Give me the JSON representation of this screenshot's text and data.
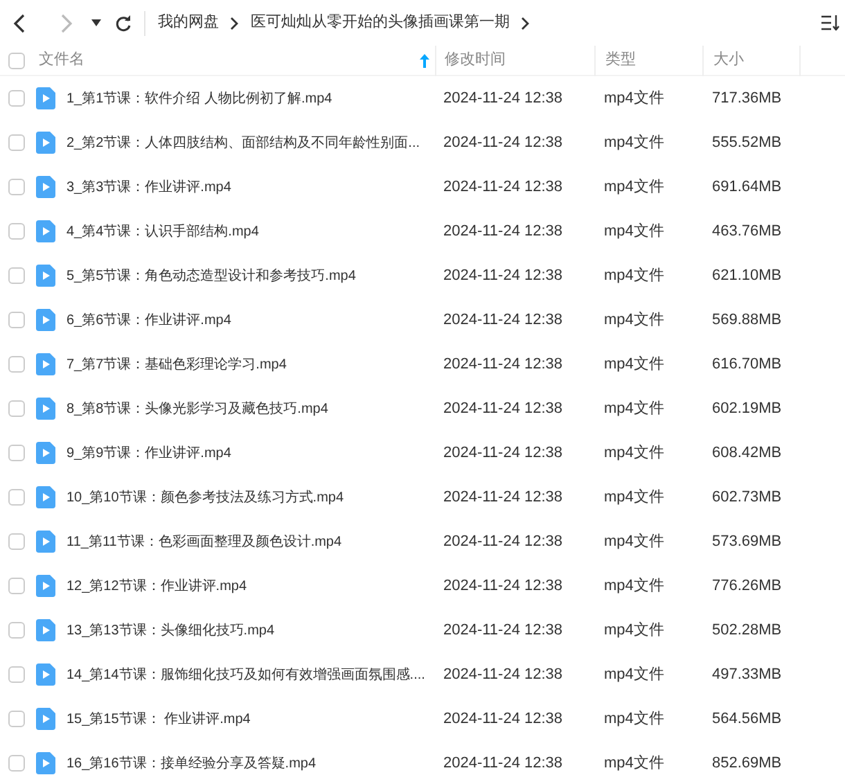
{
  "breadcrumb": [
    "我的网盘",
    "医可灿灿从零开始的头像插画课第一期"
  ],
  "columns": [
    {
      "label": "文件名",
      "sorted": true
    },
    {
      "label": "修改时间",
      "sorted": false
    },
    {
      "label": "类型",
      "sorted": false
    },
    {
      "label": "大小",
      "sorted": false
    }
  ],
  "select_all": {
    "checked": false
  },
  "rows": [
    {
      "name": "1_第1节课：软件介绍 人物比例初了解.mp4",
      "modified": "2024-11-24 12:38",
      "type": "mp4文件",
      "size": "717.36MB",
      "checked": false
    },
    {
      "name": "2_第2节课：人体四肢结构、面部结构及不同年龄性别面...",
      "modified": "2024-11-24 12:38",
      "type": "mp4文件",
      "size": "555.52MB",
      "checked": false
    },
    {
      "name": "3_第3节课：作业讲评.mp4",
      "modified": "2024-11-24 12:38",
      "type": "mp4文件",
      "size": "691.64MB",
      "checked": false
    },
    {
      "name": "4_第4节课：认识手部结构.mp4",
      "modified": "2024-11-24 12:38",
      "type": "mp4文件",
      "size": "463.76MB",
      "checked": false
    },
    {
      "name": "5_第5节课：角色动态造型设计和参考技巧.mp4",
      "modified": "2024-11-24 12:38",
      "type": "mp4文件",
      "size": "621.10MB",
      "checked": false
    },
    {
      "name": "6_第6节课：作业讲评.mp4",
      "modified": "2024-11-24 12:38",
      "type": "mp4文件",
      "size": "569.88MB",
      "checked": false
    },
    {
      "name": "7_第7节课：基础色彩理论学习.mp4",
      "modified": "2024-11-24 12:38",
      "type": "mp4文件",
      "size": "616.70MB",
      "checked": false
    },
    {
      "name": "8_第8节课：头像光影学习及藏色技巧.mp4",
      "modified": "2024-11-24 12:38",
      "type": "mp4文件",
      "size": "602.19MB",
      "checked": false
    },
    {
      "name": "9_第9节课：作业讲评.mp4",
      "modified": "2024-11-24 12:38",
      "type": "mp4文件",
      "size": "608.42MB",
      "checked": false
    },
    {
      "name": "10_第10节课：颜色参考技法及练习方式.mp4",
      "modified": "2024-11-24 12:38",
      "type": "mp4文件",
      "size": "602.73MB",
      "checked": false
    },
    {
      "name": "11_第11节课：色彩画面整理及颜色设计.mp4",
      "modified": "2024-11-24 12:38",
      "type": "mp4文件",
      "size": "573.69MB",
      "checked": false
    },
    {
      "name": "12_第12节课：作业讲评.mp4",
      "modified": "2024-11-24 12:38",
      "type": "mp4文件",
      "size": "776.26MB",
      "checked": false
    },
    {
      "name": "13_第13节课：头像细化技巧.mp4",
      "modified": "2024-11-24 12:38",
      "type": "mp4文件",
      "size": "502.28MB",
      "checked": false
    },
    {
      "name": "14_第14节课：服饰细化技巧及如何有效增强画面氛围感....",
      "modified": "2024-11-24 12:38",
      "type": "mp4文件",
      "size": "497.33MB",
      "checked": false
    },
    {
      "name": "15_第15节课： 作业讲评.mp4",
      "modified": "2024-11-24 12:38",
      "type": "mp4文件",
      "size": "564.56MB",
      "checked": false
    },
    {
      "name": "16_第16节课：接单经验分享及答疑.mp4",
      "modified": "2024-11-24 12:38",
      "type": "mp4文件",
      "size": "852.69MB",
      "checked": false
    }
  ]
}
